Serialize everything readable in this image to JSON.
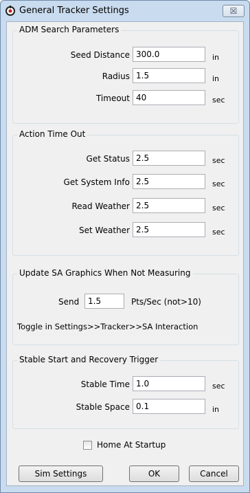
{
  "window": {
    "title": "General Tracker Settings",
    "close_glyph": "☒"
  },
  "adm": {
    "title": "ADM Search Parameters",
    "rows": [
      {
        "label": "Seed Distance",
        "value": "300.0",
        "unit": "in"
      },
      {
        "label": "Radius",
        "value": "1.5",
        "unit": "in"
      },
      {
        "label": "Timeout",
        "value": "40",
        "unit": "sec"
      }
    ]
  },
  "action": {
    "title": "Action Time Out",
    "rows": [
      {
        "label": "Get Status",
        "value": "2.5",
        "unit": "sec"
      },
      {
        "label": "Get System Info",
        "value": "2.5",
        "unit": "sec"
      },
      {
        "label": "Read Weather",
        "value": "2.5",
        "unit": "sec"
      },
      {
        "label": "Set Weather",
        "value": "2.5",
        "unit": "sec"
      }
    ]
  },
  "graphics": {
    "title": "Update SA Graphics When Not Measuring",
    "send_label": "Send",
    "send_value": "1.5",
    "send_unit": "Pts/Sec (not>10)",
    "toggle_note": "Toggle in Settings>>Tracker>>SA Interaction"
  },
  "stable": {
    "title": "Stable Start and Recovery Trigger",
    "rows": [
      {
        "label": "Stable Time",
        "value": "1.0",
        "unit": "sec"
      },
      {
        "label": "Stable Space",
        "value": "0.1",
        "unit": "in"
      }
    ]
  },
  "home_at_startup": {
    "label": "Home At Startup",
    "checked": false
  },
  "buttons": {
    "sim_settings": "Sim Settings",
    "ok": "OK",
    "cancel": "Cancel"
  }
}
